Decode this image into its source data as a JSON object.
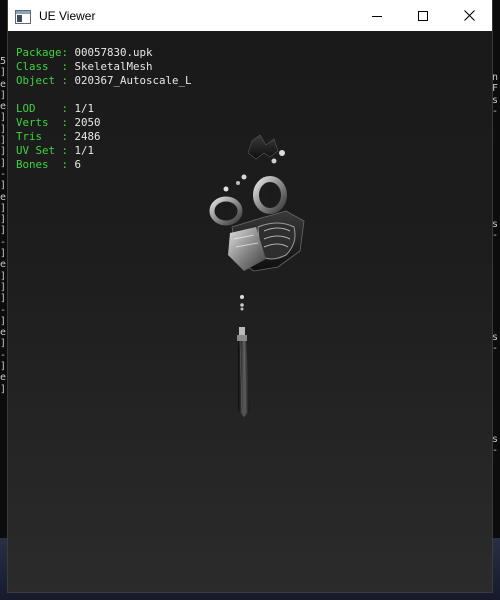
{
  "window": {
    "title": "UE Viewer",
    "icon": "app-window-icon",
    "controls": {
      "minimize_icon": "minimize-icon",
      "maximize_icon": "maximize-icon",
      "close_icon": "close-icon"
    }
  },
  "info": {
    "package_label": "Package:",
    "package_value": "00057830.upk",
    "class_label": "Class  :",
    "class_value": "SkeletalMesh",
    "object_label": "Object :",
    "object_value": "020367_Autoscale_L",
    "lod_label": "LOD    :",
    "lod_value": "1/1",
    "verts_label": "Verts  :",
    "verts_value": "2050",
    "tris_label": "Tris   :",
    "tris_value": "2486",
    "uvset_label": "UV Set :",
    "uvset_value": "1/1",
    "bones_label": "Bones  :",
    "bones_value": "6"
  },
  "background": {
    "left_strip": "5\n]\ne\n]\ne\n]\n]\n]\n]\n]\n-\n]\ne\n]\n]\n]\n-\n]\ne\n]\n]\n]\n-\n]\ne\n]\n-\n]\ne\n]",
    "right_strip": "n\nF\ns\n-\n\n\n\n\n\n\n\n\n\ns\n-\n\n\n\n\n\n\n\n\ns\n-\n\n\n\n\n\n\n\ns\n-"
  },
  "colors": {
    "label": "#3ed43e",
    "value": "#e8e8e8",
    "titlebar": "#ffffff"
  }
}
